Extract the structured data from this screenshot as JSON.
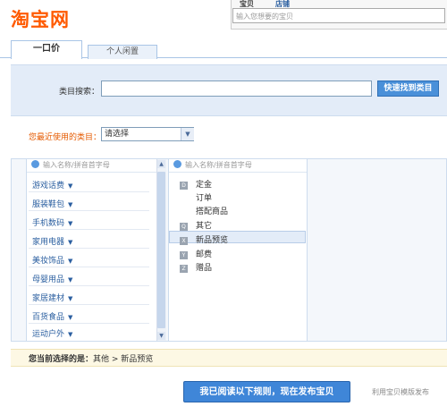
{
  "header": {
    "logo": "淘宝网",
    "search_tabs": [
      "宝贝",
      "店铺"
    ],
    "search_placeholder": "输入您想要的宝贝"
  },
  "tabs": [
    {
      "label": "一口价",
      "active": true
    },
    {
      "label": "个人闲置",
      "active": false
    }
  ],
  "category_search": {
    "label": "类目搜索：",
    "value": "",
    "button": "快速找到类目"
  },
  "recent": {
    "label": "您最近使用的类目：",
    "selected": "请选择",
    "arrow": "▼"
  },
  "picker": {
    "filter_placeholder": "输入名称/拼音首字母",
    "categories": [
      "游戏话费",
      "服装鞋包",
      "手机数码",
      "家用电器",
      "美妆饰品",
      "母婴用品",
      "家居建材",
      "百货食品",
      "运动户外"
    ],
    "subcategories": [
      {
        "badge": "D",
        "label": "定金"
      },
      {
        "badge": "",
        "label": "订单"
      },
      {
        "badge": "",
        "label": "搭配商品"
      },
      {
        "badge": "Q",
        "label": "其它"
      },
      {
        "badge": "X",
        "label": "新品预览",
        "selected": true
      },
      {
        "badge": "Y",
        "label": "邮费"
      },
      {
        "badge": "Z",
        "label": "赠品"
      }
    ],
    "scroll_up": "▲",
    "scroll_down": "▼",
    "caret": "▼"
  },
  "selection": {
    "label": "您当前选择的是：",
    "path": "其他 > 新品预览"
  },
  "footer": {
    "publish_button": "我已阅读以下规则，现在发布宝贝",
    "template_link": "利用宝贝模版发布"
  }
}
